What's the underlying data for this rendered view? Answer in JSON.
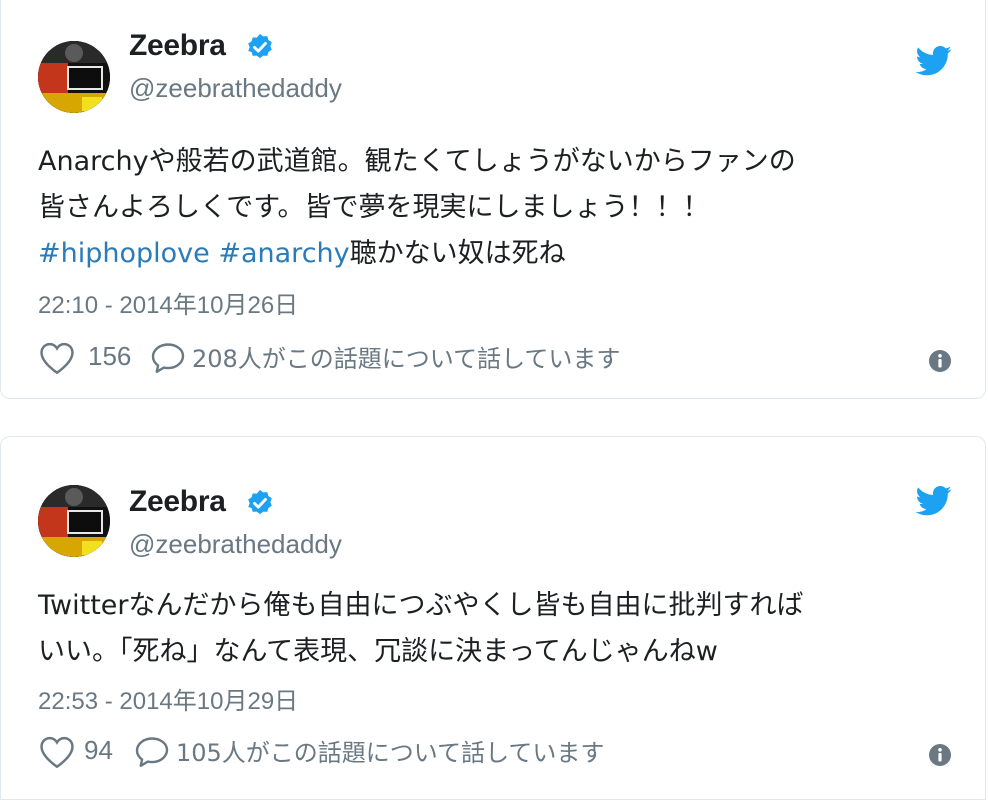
{
  "colors": {
    "link": "#2b7bb9",
    "secondary": "#697882",
    "verified": "#1da1f2",
    "twitter_blue": "#1da1f2"
  },
  "tweets": [
    {
      "author": {
        "name": "Zeebra",
        "handle": "@zeebrathedaddy",
        "verified": true
      },
      "text_lines": [
        "Anarchyや般若の武道館。観たくてしょうがないからファンの",
        "皆さんよろしくです。皆で夢を現実にしましょう！！！"
      ],
      "hashtag_1": "#hiphoplove",
      "hashtag_2": "#anarchy",
      "text_tail": "聴かない奴は死ね",
      "timestamp": "22:10 - 2014年10月26日",
      "likes": "156",
      "replies": "208人がこの話題について話しています",
      "icons": [
        "avatar",
        "verified-badge-icon",
        "twitter-bird-icon",
        "heart-icon",
        "reply-bubble-icon",
        "info-icon"
      ]
    },
    {
      "author": {
        "name": "Zeebra",
        "handle": "@zeebrathedaddy",
        "verified": true
      },
      "text_lines": [
        "Twitterなんだから俺も自由につぶやくし皆も自由に批判すれば",
        "いい。「死ね」なんて表現、冗談に決まってんじゃんねw"
      ],
      "timestamp": "22:53 - 2014年10月29日",
      "likes": "94",
      "replies": "105人がこの話題について話しています",
      "icons": [
        "avatar",
        "verified-badge-icon",
        "twitter-bird-icon",
        "heart-icon",
        "reply-bubble-icon",
        "info-icon"
      ]
    }
  ]
}
